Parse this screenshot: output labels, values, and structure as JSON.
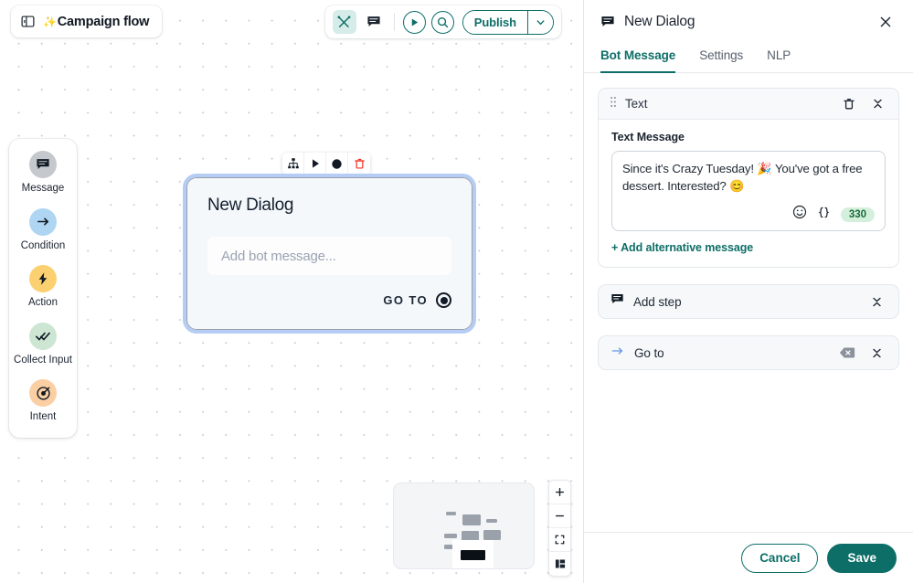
{
  "flow": {
    "title": "Campaign flow",
    "sparkle": "✨",
    "panel_toggle_icon": "sidebar-toggle-icon"
  },
  "toolbar": {
    "tools_icon": "crossed-tools-icon",
    "comment_icon": "comment-icon",
    "play_icon": "play-icon",
    "search_icon": "search-icon",
    "publish_label": "Publish",
    "caret_icon": "chevron-down-icon"
  },
  "palette": {
    "items": [
      {
        "label": "Message",
        "icon": "message-icon",
        "color": "#c5c8cc"
      },
      {
        "label": "Condition",
        "icon": "arrow-right-icon",
        "color": "#aed5f2"
      },
      {
        "label": "Action",
        "icon": "lightning-icon",
        "color": "#fbd071"
      },
      {
        "label": "Collect Input",
        "icon": "double-check-icon",
        "color": "#cce6d3"
      },
      {
        "label": "Intent",
        "icon": "target-icon",
        "color": "#fbcfa3"
      }
    ]
  },
  "node_toolbar": {
    "buttons": [
      {
        "icon": "sitemap-icon"
      },
      {
        "icon": "play-icon"
      },
      {
        "icon": "circle-filled-icon"
      },
      {
        "icon": "trash-icon"
      }
    ]
  },
  "node": {
    "title": "New Dialog",
    "message_placeholder": "Add bot message...",
    "goto_label": "GO TO",
    "connector_icon": "connector-dot-icon"
  },
  "minimap": {
    "name": "minimap"
  },
  "zoom_controls": {
    "zoom_in_icon": "plus-icon",
    "zoom_out_icon": "minus-icon",
    "fit_view_icon": "fit-screen-icon",
    "layout_icon": "layout-panels-icon"
  },
  "panel": {
    "icon": "message-icon",
    "title": "New Dialog",
    "close_icon": "close-icon",
    "tabs": [
      {
        "label": "Bot Message",
        "active": true
      },
      {
        "label": "Settings",
        "active": false
      },
      {
        "label": "NLP",
        "active": false
      }
    ],
    "text_card": {
      "drag_icon": "drag-handle-icon",
      "title": "Text",
      "delete_icon": "trash-icon",
      "collapse_icon": "collapse-chevrons-icon",
      "field_label": "Text Message",
      "message_value": "Since it's Crazy Tuesday! 🎉 You've got a free dessert. Interested? 😊",
      "emoji_icon": "emoji-icon",
      "variable_icon": "curly-braces-icon",
      "char_count": "330",
      "alt_message_label": "+ Add alternative message"
    },
    "add_step": {
      "icon": "message-icon",
      "label": "Add step",
      "collapse_icon": "collapse-chevrons-icon"
    },
    "go_to": {
      "icon": "arrow-right-icon",
      "label": "Go to",
      "clear_icon": "backspace-icon",
      "collapse_icon": "collapse-chevrons-icon"
    },
    "footer": {
      "cancel_label": "Cancel",
      "save_label": "Save"
    }
  },
  "colors": {
    "accent": "#0d6e68",
    "selection": "#b5cdf4",
    "badge_green": "#d4f0dd"
  }
}
